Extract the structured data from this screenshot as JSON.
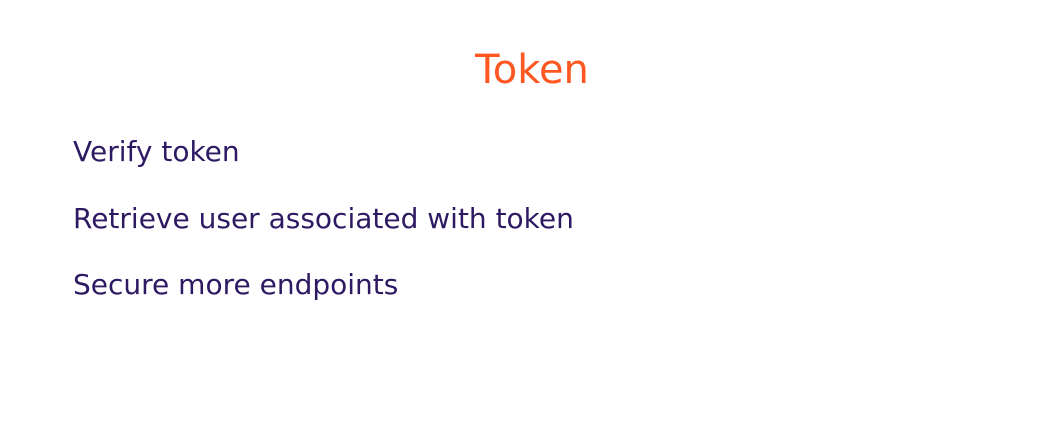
{
  "slide": {
    "title": "Token",
    "items": [
      {
        "label": "Verify token"
      },
      {
        "label": "Retrieve user associated with token"
      },
      {
        "label": "Secure more endpoints"
      }
    ]
  },
  "colors": {
    "title": "#ff5722",
    "text": "#2d1a63",
    "background": "#ffffff"
  }
}
